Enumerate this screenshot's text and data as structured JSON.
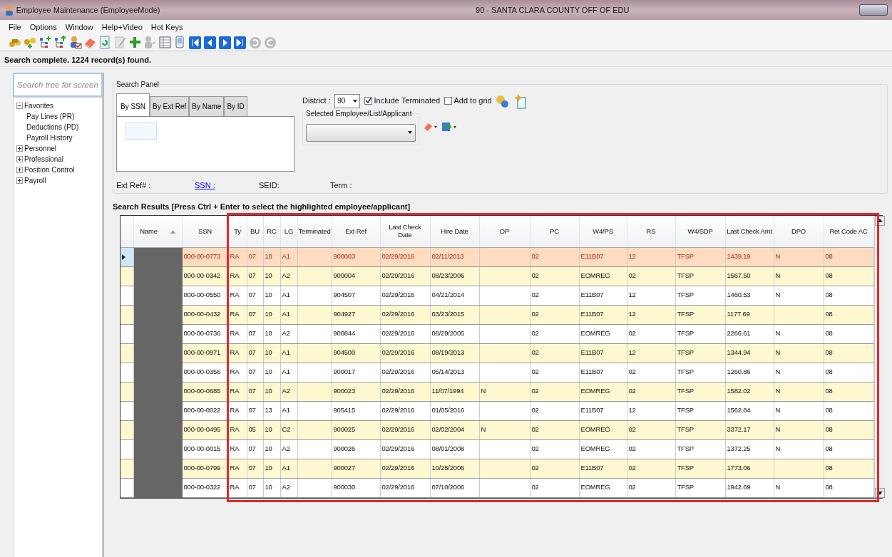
{
  "window": {
    "title": "Employee Maintenance (EmployeeMode)",
    "subtitle": "90 - SANTA CLARA COUNTY OFF OF EDU"
  },
  "menu": [
    "File",
    "Options",
    "Window",
    "Help+Video",
    "Hot Keys"
  ],
  "status": "Search complete. 1224 record(s) found.",
  "tree": {
    "placeholder": "Search tree for screen",
    "items": [
      {
        "label": "Favorites",
        "expanded": true,
        "children": [
          {
            "label": "Pay Lines (PR)"
          },
          {
            "label": "Deductions (PD)"
          },
          {
            "label": "Payroll History"
          }
        ]
      },
      {
        "label": "Personnel",
        "expanded": false
      },
      {
        "label": "Professional",
        "expanded": false
      },
      {
        "label": "Position Control",
        "expanded": false
      },
      {
        "label": "Payroll",
        "expanded": false
      }
    ]
  },
  "search_panel": {
    "title": "Search Panel",
    "tabs": [
      {
        "label": "By SSN",
        "selected": true
      },
      {
        "label": "By Ext Ref",
        "selected": false
      },
      {
        "label": "By Name",
        "selected": false
      },
      {
        "label": "By ID",
        "selected": false
      }
    ],
    "district_label": "District :",
    "district_value": "90",
    "checkboxes": [
      {
        "label": "Include Terminated",
        "checked": true
      },
      {
        "label": "Add to grid",
        "checked": false
      }
    ],
    "selected_group": "Selected Employee/List/Applicant",
    "info": [
      {
        "label": "Ext Ref# :",
        "kind": "text"
      },
      {
        "label": "SSN :",
        "kind": "link"
      },
      {
        "label": "SEID:",
        "kind": "text"
      },
      {
        "label": "Term :",
        "kind": "text"
      }
    ]
  },
  "results": {
    "title": "Search Results [Press Ctrl + Enter to select the highlighted employee/applicant]",
    "columns": [
      {
        "label": "Name",
        "sorted": true
      },
      {
        "label": "SSN"
      },
      {
        "label": "Ty"
      },
      {
        "label": "BU"
      },
      {
        "label": "RC"
      },
      {
        "label": "LG"
      },
      {
        "label": "Terminated"
      },
      {
        "label": "Ext Ref"
      },
      {
        "label": "Last Check Date"
      },
      {
        "label": "Hire Date"
      },
      {
        "label": "OP"
      },
      {
        "label": "PC"
      },
      {
        "label": "W4/PS"
      },
      {
        "label": "RS"
      },
      {
        "label": "W4/SDP"
      },
      {
        "label": "Last Check Amt"
      },
      {
        "label": "DPO"
      },
      {
        "label": "Ret Code AC"
      }
    ],
    "rows": [
      {
        "selected": true,
        "shaded": false,
        "name_redacted": true,
        "cells": [
          "",
          "000-00-0773",
          "RA",
          "07",
          "10",
          "A1",
          "",
          "900003",
          "02/29/2016",
          "02/11/2013",
          "",
          "02",
          "E11B07",
          "12",
          "TFSP",
          "1439.19",
          "N",
          "08"
        ]
      },
      {
        "selected": false,
        "shaded": true,
        "name_redacted": true,
        "cells": [
          "",
          "000-00-0342",
          "RA",
          "07",
          "10",
          "A2",
          "",
          "900004",
          "02/29/2016",
          "08/23/2006",
          "",
          "02",
          "EOMREG",
          "02",
          "TFSP",
          "1567.50",
          "N",
          "08"
        ]
      },
      {
        "selected": false,
        "shaded": false,
        "name_redacted": true,
        "cells": [
          "",
          "000-00-0550",
          "RA",
          "07",
          "10",
          "A1",
          "",
          "904507",
          "02/29/2016",
          "04/21/2014",
          "",
          "02",
          "E11B07",
          "12",
          "TFSP",
          "1460.53",
          "N",
          "08"
        ]
      },
      {
        "selected": false,
        "shaded": true,
        "name_redacted": true,
        "cells": [
          "",
          "000-00-0432",
          "RA",
          "07",
          "10",
          "A1",
          "",
          "904927",
          "02/29/2016",
          "03/23/2015",
          "",
          "02",
          "E11B07",
          "12",
          "TFSP",
          "1177.69",
          "",
          "08"
        ]
      },
      {
        "selected": false,
        "shaded": false,
        "name_redacted": true,
        "cells": [
          "",
          "000-00-0736",
          "RA",
          "07",
          "10",
          "A2",
          "",
          "900844",
          "02/29/2016",
          "08/29/2005",
          "",
          "02",
          "EOMREG",
          "02",
          "TFSP",
          "2266.61",
          "N",
          "08"
        ]
      },
      {
        "selected": false,
        "shaded": true,
        "name_redacted": true,
        "cells": [
          "",
          "000-00-0971",
          "RA",
          "07",
          "10",
          "A1",
          "",
          "904500",
          "02/29/2016",
          "08/19/2013",
          "",
          "02",
          "E11B07",
          "12",
          "TFSP",
          "1344.94",
          "N",
          "08"
        ]
      },
      {
        "selected": false,
        "shaded": false,
        "name_redacted": true,
        "cells": [
          "",
          "000-00-0356",
          "RA",
          "07",
          "10",
          "A1",
          "",
          "900017",
          "02/29/2016",
          "05/14/2013",
          "",
          "02",
          "E11B07",
          "02",
          "TFSP",
          "1260.86",
          "N",
          "08"
        ]
      },
      {
        "selected": false,
        "shaded": true,
        "name_redacted": true,
        "cells": [
          "",
          "000-00-0685",
          "RA",
          "07",
          "10",
          "A2",
          "",
          "900023",
          "02/29/2016",
          "11/07/1994",
          "N",
          "02",
          "EOMREG",
          "02",
          "TFSP",
          "1582.02",
          "N",
          "08"
        ]
      },
      {
        "selected": false,
        "shaded": false,
        "name_redacted": true,
        "cells": [
          "",
          "000-00-0022",
          "RA",
          "07",
          "13",
          "A1",
          "",
          "905415",
          "02/29/2016",
          "01/05/2016",
          "",
          "02",
          "E11B07",
          "12",
          "TFSP",
          "1562.84",
          "N",
          "08"
        ]
      },
      {
        "selected": false,
        "shaded": true,
        "name_redacted": true,
        "cells": [
          "",
          "000-00-0495",
          "RA",
          "05",
          "10",
          "C2",
          "",
          "900025",
          "02/29/2016",
          "02/02/2004",
          "N",
          "02",
          "EOMREG",
          "02",
          "TFSP",
          "3372.17",
          "N",
          "08"
        ]
      },
      {
        "selected": false,
        "shaded": false,
        "name_redacted": true,
        "cells": [
          "",
          "000-00-0015",
          "RA",
          "07",
          "10",
          "A2",
          "",
          "900026",
          "02/29/2016",
          "08/01/2008",
          "",
          "02",
          "EOMREG",
          "02",
          "TFSP",
          "1372.25",
          "N",
          "08"
        ]
      },
      {
        "selected": false,
        "shaded": true,
        "name_redacted": true,
        "cells": [
          "",
          "000-00-0799",
          "RA",
          "07",
          "10",
          "A1",
          "",
          "900027",
          "02/29/2016",
          "10/25/2006",
          "",
          "02",
          "E11B07",
          "02",
          "TFSP",
          "1773.06",
          "",
          "08"
        ]
      },
      {
        "selected": false,
        "shaded": false,
        "name_redacted": true,
        "cells": [
          "",
          "000-00-0322",
          "RA",
          "07",
          "10",
          "A2",
          "",
          "900030",
          "02/29/2016",
          "07/10/2006",
          "",
          "02",
          "EOMREG",
          "02",
          "TFSP",
          "1942.69",
          "N",
          "08"
        ]
      }
    ]
  }
}
